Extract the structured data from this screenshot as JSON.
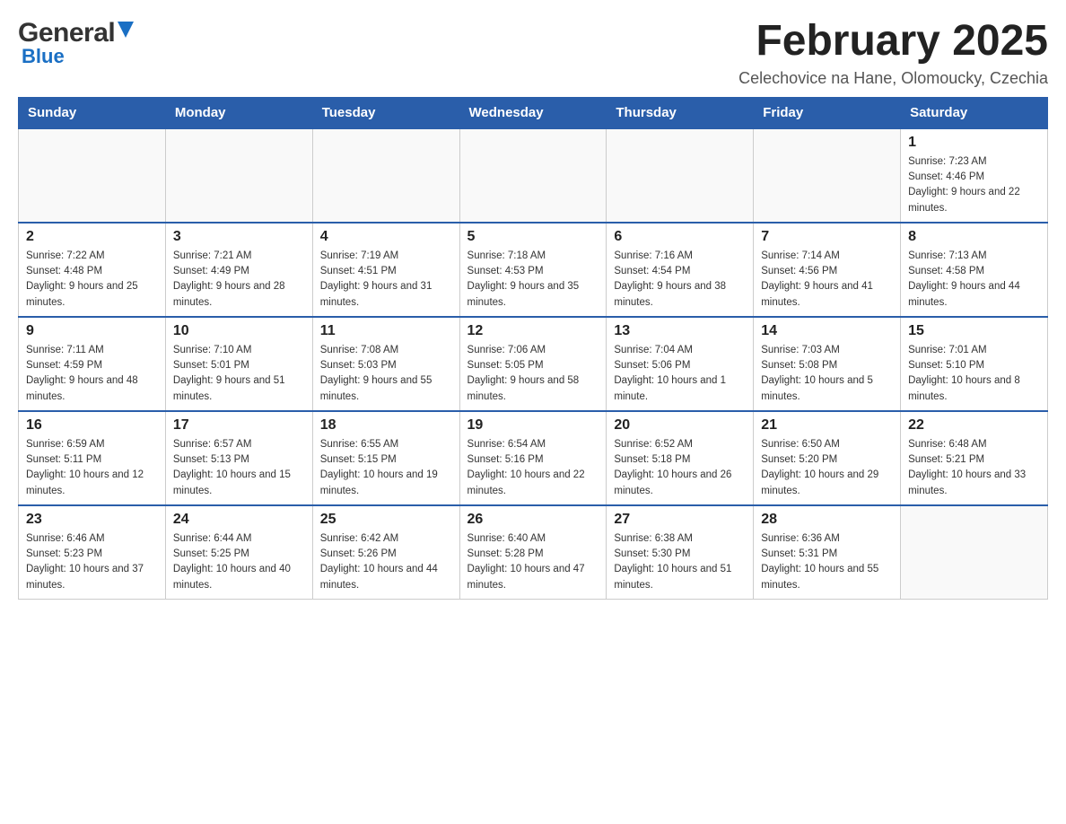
{
  "header": {
    "logo": {
      "general": "General",
      "triangle_symbol": "▲",
      "blue": "Blue"
    },
    "title": "February 2025",
    "location": "Celechovice na Hane, Olomoucky, Czechia"
  },
  "days_of_week": [
    "Sunday",
    "Monday",
    "Tuesday",
    "Wednesday",
    "Thursday",
    "Friday",
    "Saturday"
  ],
  "weeks": [
    {
      "days": [
        {
          "empty": true
        },
        {
          "empty": true
        },
        {
          "empty": true
        },
        {
          "empty": true
        },
        {
          "empty": true
        },
        {
          "empty": true
        },
        {
          "number": "1",
          "sunrise": "Sunrise: 7:23 AM",
          "sunset": "Sunset: 4:46 PM",
          "daylight": "Daylight: 9 hours and 22 minutes."
        }
      ]
    },
    {
      "days": [
        {
          "number": "2",
          "sunrise": "Sunrise: 7:22 AM",
          "sunset": "Sunset: 4:48 PM",
          "daylight": "Daylight: 9 hours and 25 minutes."
        },
        {
          "number": "3",
          "sunrise": "Sunrise: 7:21 AM",
          "sunset": "Sunset: 4:49 PM",
          "daylight": "Daylight: 9 hours and 28 minutes."
        },
        {
          "number": "4",
          "sunrise": "Sunrise: 7:19 AM",
          "sunset": "Sunset: 4:51 PM",
          "daylight": "Daylight: 9 hours and 31 minutes."
        },
        {
          "number": "5",
          "sunrise": "Sunrise: 7:18 AM",
          "sunset": "Sunset: 4:53 PM",
          "daylight": "Daylight: 9 hours and 35 minutes."
        },
        {
          "number": "6",
          "sunrise": "Sunrise: 7:16 AM",
          "sunset": "Sunset: 4:54 PM",
          "daylight": "Daylight: 9 hours and 38 minutes."
        },
        {
          "number": "7",
          "sunrise": "Sunrise: 7:14 AM",
          "sunset": "Sunset: 4:56 PM",
          "daylight": "Daylight: 9 hours and 41 minutes."
        },
        {
          "number": "8",
          "sunrise": "Sunrise: 7:13 AM",
          "sunset": "Sunset: 4:58 PM",
          "daylight": "Daylight: 9 hours and 44 minutes."
        }
      ]
    },
    {
      "days": [
        {
          "number": "9",
          "sunrise": "Sunrise: 7:11 AM",
          "sunset": "Sunset: 4:59 PM",
          "daylight": "Daylight: 9 hours and 48 minutes."
        },
        {
          "number": "10",
          "sunrise": "Sunrise: 7:10 AM",
          "sunset": "Sunset: 5:01 PM",
          "daylight": "Daylight: 9 hours and 51 minutes."
        },
        {
          "number": "11",
          "sunrise": "Sunrise: 7:08 AM",
          "sunset": "Sunset: 5:03 PM",
          "daylight": "Daylight: 9 hours and 55 minutes."
        },
        {
          "number": "12",
          "sunrise": "Sunrise: 7:06 AM",
          "sunset": "Sunset: 5:05 PM",
          "daylight": "Daylight: 9 hours and 58 minutes."
        },
        {
          "number": "13",
          "sunrise": "Sunrise: 7:04 AM",
          "sunset": "Sunset: 5:06 PM",
          "daylight": "Daylight: 10 hours and 1 minute."
        },
        {
          "number": "14",
          "sunrise": "Sunrise: 7:03 AM",
          "sunset": "Sunset: 5:08 PM",
          "daylight": "Daylight: 10 hours and 5 minutes."
        },
        {
          "number": "15",
          "sunrise": "Sunrise: 7:01 AM",
          "sunset": "Sunset: 5:10 PM",
          "daylight": "Daylight: 10 hours and 8 minutes."
        }
      ]
    },
    {
      "days": [
        {
          "number": "16",
          "sunrise": "Sunrise: 6:59 AM",
          "sunset": "Sunset: 5:11 PM",
          "daylight": "Daylight: 10 hours and 12 minutes."
        },
        {
          "number": "17",
          "sunrise": "Sunrise: 6:57 AM",
          "sunset": "Sunset: 5:13 PM",
          "daylight": "Daylight: 10 hours and 15 minutes."
        },
        {
          "number": "18",
          "sunrise": "Sunrise: 6:55 AM",
          "sunset": "Sunset: 5:15 PM",
          "daylight": "Daylight: 10 hours and 19 minutes."
        },
        {
          "number": "19",
          "sunrise": "Sunrise: 6:54 AM",
          "sunset": "Sunset: 5:16 PM",
          "daylight": "Daylight: 10 hours and 22 minutes."
        },
        {
          "number": "20",
          "sunrise": "Sunrise: 6:52 AM",
          "sunset": "Sunset: 5:18 PM",
          "daylight": "Daylight: 10 hours and 26 minutes."
        },
        {
          "number": "21",
          "sunrise": "Sunrise: 6:50 AM",
          "sunset": "Sunset: 5:20 PM",
          "daylight": "Daylight: 10 hours and 29 minutes."
        },
        {
          "number": "22",
          "sunrise": "Sunrise: 6:48 AM",
          "sunset": "Sunset: 5:21 PM",
          "daylight": "Daylight: 10 hours and 33 minutes."
        }
      ]
    },
    {
      "days": [
        {
          "number": "23",
          "sunrise": "Sunrise: 6:46 AM",
          "sunset": "Sunset: 5:23 PM",
          "daylight": "Daylight: 10 hours and 37 minutes."
        },
        {
          "number": "24",
          "sunrise": "Sunrise: 6:44 AM",
          "sunset": "Sunset: 5:25 PM",
          "daylight": "Daylight: 10 hours and 40 minutes."
        },
        {
          "number": "25",
          "sunrise": "Sunrise: 6:42 AM",
          "sunset": "Sunset: 5:26 PM",
          "daylight": "Daylight: 10 hours and 44 minutes."
        },
        {
          "number": "26",
          "sunrise": "Sunrise: 6:40 AM",
          "sunset": "Sunset: 5:28 PM",
          "daylight": "Daylight: 10 hours and 47 minutes."
        },
        {
          "number": "27",
          "sunrise": "Sunrise: 6:38 AM",
          "sunset": "Sunset: 5:30 PM",
          "daylight": "Daylight: 10 hours and 51 minutes."
        },
        {
          "number": "28",
          "sunrise": "Sunrise: 6:36 AM",
          "sunset": "Sunset: 5:31 PM",
          "daylight": "Daylight: 10 hours and 55 minutes."
        },
        {
          "empty": true
        }
      ]
    }
  ]
}
